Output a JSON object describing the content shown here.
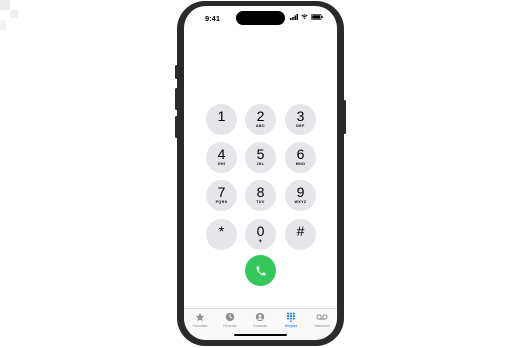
{
  "status_bar": {
    "time": "9:41"
  },
  "keypad": {
    "keys": [
      {
        "digit": "1",
        "letters": ""
      },
      {
        "digit": "2",
        "letters": "ABC"
      },
      {
        "digit": "3",
        "letters": "DEF"
      },
      {
        "digit": "4",
        "letters": "GHI"
      },
      {
        "digit": "5",
        "letters": "JKL"
      },
      {
        "digit": "6",
        "letters": "MNO"
      },
      {
        "digit": "7",
        "letters": "PQRS"
      },
      {
        "digit": "8",
        "letters": "TUV"
      },
      {
        "digit": "9",
        "letters": "WXYZ"
      },
      {
        "digit": "*",
        "letters": ""
      },
      {
        "digit": "0",
        "letters": "+"
      },
      {
        "digit": "#",
        "letters": ""
      }
    ],
    "call_icon": "phone-icon"
  },
  "tabbar": {
    "tabs": [
      {
        "label": "Favorites",
        "icon": "star-icon"
      },
      {
        "label": "Recents",
        "icon": "clock-icon"
      },
      {
        "label": "Contacts",
        "icon": "person-icon"
      },
      {
        "label": "Keypad",
        "icon": "keypad-icon",
        "active": true
      },
      {
        "label": "Voicemail",
        "icon": "voicemail-icon"
      }
    ]
  },
  "colors": {
    "accent": "#007aff",
    "call": "#34c759",
    "key_bg": "#e5e5ea"
  }
}
